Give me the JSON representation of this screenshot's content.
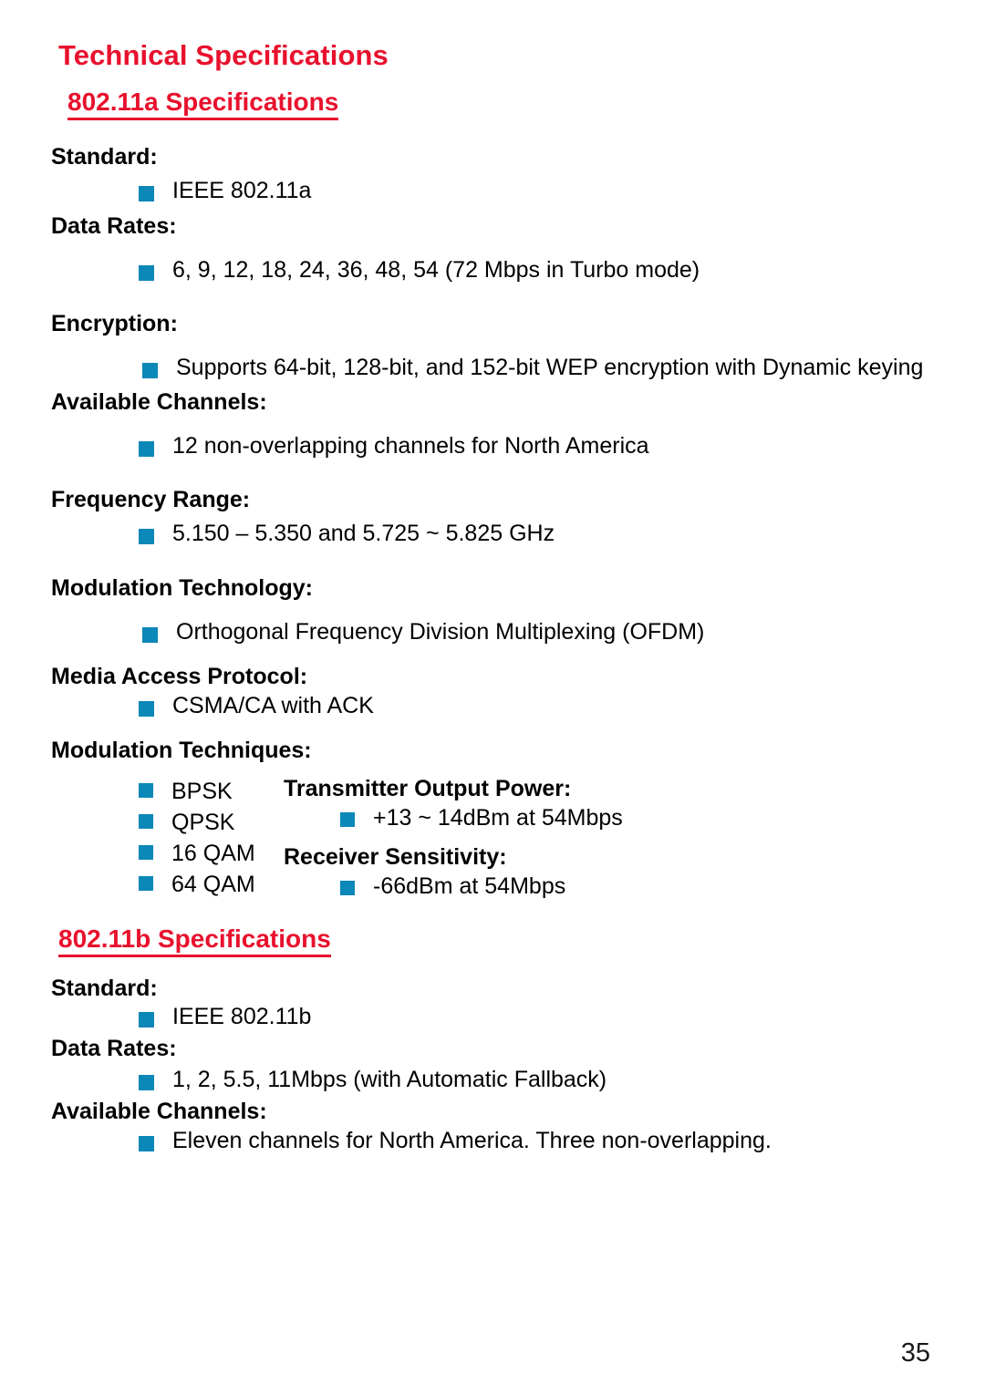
{
  "document": {
    "title": "Technical Specifications",
    "page_number": "35"
  },
  "colors": {
    "heading_red": "#e8112d",
    "bullet_blue": "#0b87b8",
    "body_text": "#000000"
  },
  "sections": [
    {
      "heading": "802.11a Specifications",
      "specs": [
        {
          "label": "Standard:",
          "items": [
            "IEEE 802.11a"
          ]
        },
        {
          "label": "Data Rates:",
          "items": [
            "6, 9, 12, 18, 24, 36, 48, 54 (72 Mbps in Turbo mode)"
          ]
        },
        {
          "label": "Encryption:",
          "items": [
            "Supports 64-bit, 128-bit, and 152-bit WEP encryption with Dynamic keying"
          ]
        },
        {
          "label": "Available Channels:",
          "items": [
            "12 non-overlapping channels for North America"
          ]
        },
        {
          "label": "Frequency Range:",
          "items": [
            "5.150 – 5.350 and 5.725 ~ 5.825 GHz"
          ]
        },
        {
          "label": "Modulation Technology:",
          "items": [
            "Orthogonal Frequency Division Multiplexing (OFDM)"
          ]
        },
        {
          "label": "Media Access Protocol:",
          "items": [
            "CSMA/CA with ACK"
          ]
        },
        {
          "label": "Modulation Techniques:",
          "items": []
        }
      ],
      "two_column": {
        "left": {
          "items": [
            "BPSK",
            "QPSK",
            "16 QAM",
            "64 QAM"
          ]
        },
        "right": {
          "specs": [
            {
              "label": "Transmitter Output Power:",
              "items": [
                "+13 ~ 14dBm at 54Mbps"
              ]
            },
            {
              "label": "Receiver Sensitivity:",
              "items": [
                "-66dBm at 54Mbps"
              ]
            }
          ]
        }
      }
    },
    {
      "heading": "802.11b Specifications",
      "specs": [
        {
          "label": "Standard:",
          "items": [
            "IEEE 802.11b"
          ]
        },
        {
          "label": "Data Rates:",
          "items": [
            "1, 2, 5.5, 11Mbps (with Automatic Fallback)"
          ]
        },
        {
          "label": "Available Channels:",
          "items": [
            "Eleven channels for North America.  Three non-overlapping."
          ]
        }
      ]
    }
  ]
}
